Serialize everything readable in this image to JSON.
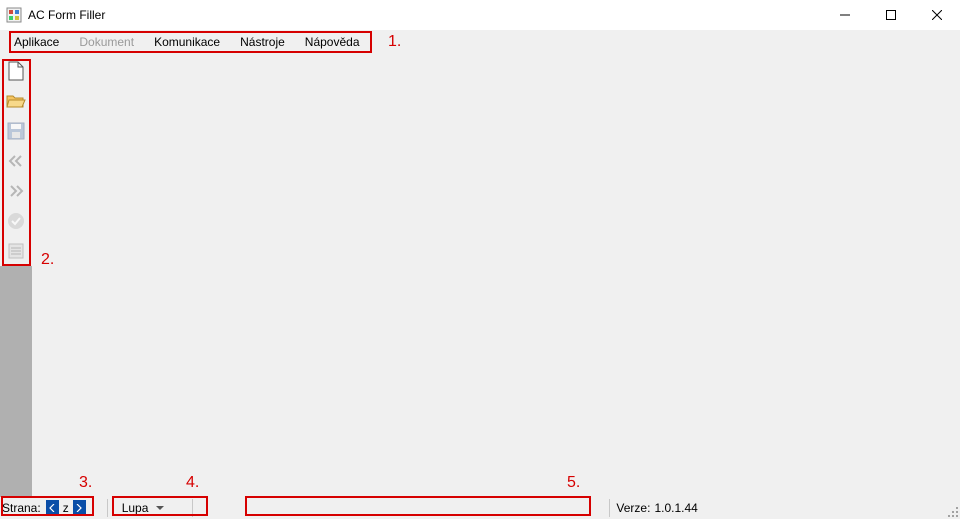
{
  "window": {
    "title": "AC Form Filler"
  },
  "menu": {
    "items": [
      {
        "label": "Aplikace",
        "disabled": false
      },
      {
        "label": "Dokument",
        "disabled": true
      },
      {
        "label": "Komunikace",
        "disabled": false
      },
      {
        "label": "Nástroje",
        "disabled": false
      },
      {
        "label": "Nápověda",
        "disabled": false
      }
    ]
  },
  "toolbar": {
    "items": [
      {
        "name": "new-file-icon",
        "disabled": false
      },
      {
        "name": "open-folder-icon",
        "disabled": false
      },
      {
        "name": "save-icon",
        "disabled": true
      },
      {
        "name": "prev-page-icon",
        "disabled": true
      },
      {
        "name": "next-page-icon",
        "disabled": true
      },
      {
        "name": "check-icon",
        "disabled": true
      },
      {
        "name": "details-icon",
        "disabled": true
      }
    ]
  },
  "status": {
    "page_label": "Strana:",
    "page_separator": "z",
    "zoom_label": "Lupa",
    "version_label": "Verze:",
    "version_value": "1.0.1.44"
  },
  "callouts": {
    "c1": "1.",
    "c2": "2.",
    "c3": "3.",
    "c4": "4.",
    "c5": "5."
  },
  "colors": {
    "callout": "#d60000",
    "page_btn_bg": "#0a4ea8",
    "disabled_text": "#9a9a9a",
    "panel_bg": "#f0f0f0"
  }
}
